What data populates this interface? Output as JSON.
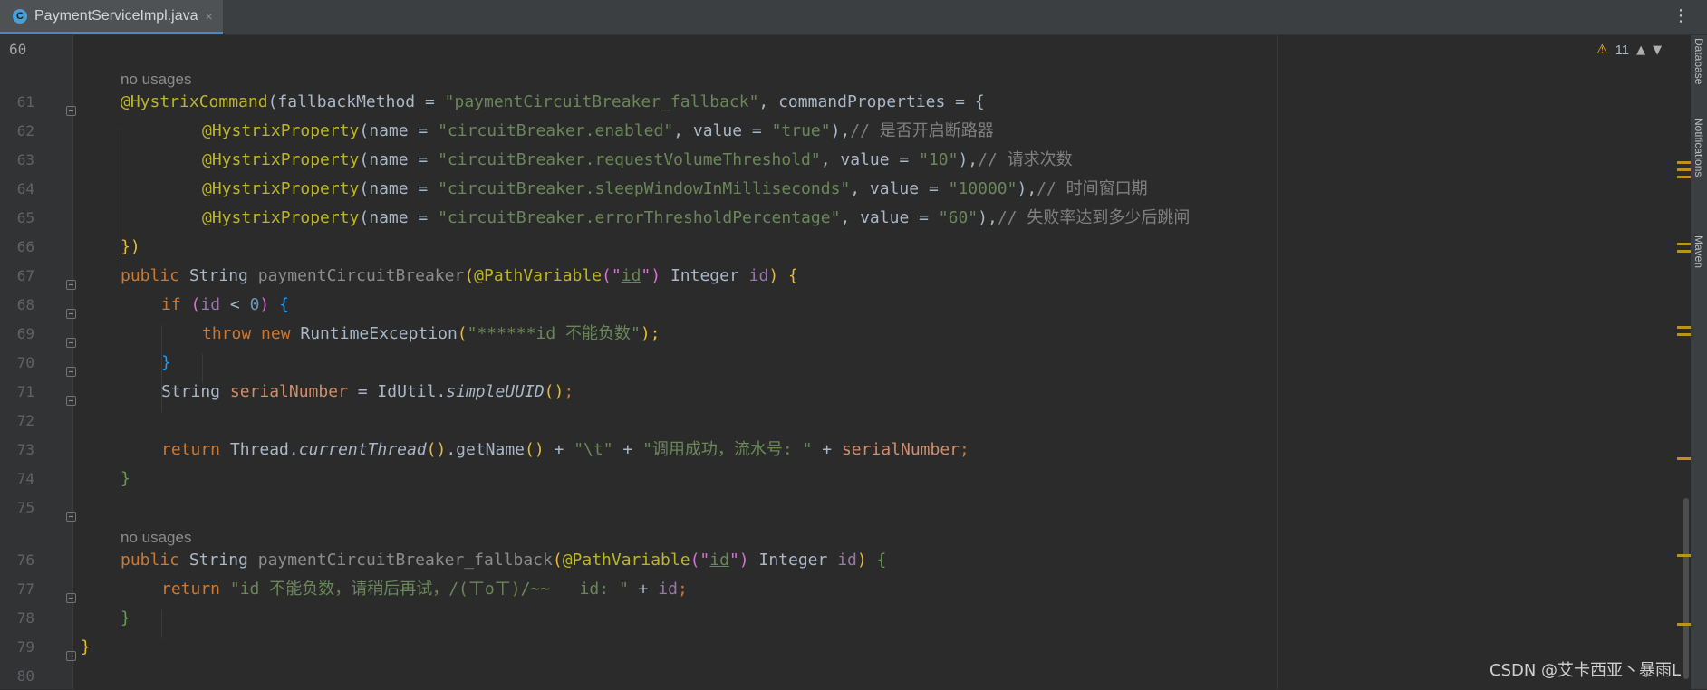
{
  "tab": {
    "icon_letter": "C",
    "title": "PaymentServiceImpl.java",
    "close": "×",
    "menu": "⋮"
  },
  "inspection": {
    "warning_count": "11"
  },
  "side_tabs": [
    "Database",
    "Notifications",
    "Maven"
  ],
  "hints": {
    "no_usages": "no usages"
  },
  "line_numbers": [
    "60",
    "61",
    "62",
    "63",
    "64",
    "65",
    "66",
    "67",
    "68",
    "69",
    "70",
    "71",
    "72",
    "73",
    "74",
    "75",
    "76",
    "77",
    "78",
    "79",
    "80"
  ],
  "code": {
    "l61_ann": "@HystrixCommand",
    "l61_a": "(fallbackMethod = ",
    "l61_s": "\"paymentCircuitBreaker_fallback\"",
    "l61_b": ", commandProperties = {",
    "prop_ann": "@HystrixProperty",
    "name_eq": "(name = ",
    "value_eq": ", value = ",
    "close_comma": "),",
    "l62_name": "\"circuitBreaker.enabled\"",
    "l62_val": "\"true\"",
    "l62_cmt": "// 是否开启断路器",
    "l63_name": "\"circuitBreaker.requestVolumeThreshold\"",
    "l63_val": "\"10\"",
    "l63_cmt": "// 请求次数",
    "l64_name": "\"circuitBreaker.sleepWindowInMilliseconds\"",
    "l64_val": "\"10000\"",
    "l64_cmt": "// 时间窗口期",
    "l65_name": "\"circuitBreaker.errorThresholdPercentage\"",
    "l65_val": "\"60\"",
    "l65_cmt": "// 失败率达到多少后跳闸",
    "l66": "})",
    "kw_public": "public",
    "type_string": " String ",
    "m1": "paymentCircuitBreaker",
    "paren_open": "(",
    "ann_pathvar": "@PathVariable",
    "q_open": "(\"",
    "id_word": "id",
    "q_close": "\")",
    "integer": " Integer ",
    "paren_close": ")",
    "brace_open": " {",
    "kw_if": "if",
    "space": " ",
    "l68_mid": " < ",
    "zero": "0",
    "kw_throw": "throw",
    "kw_new": "new",
    "runtime_ex": " RuntimeException",
    "l69_str": "\"******id 不能负数\"",
    "semi_close": ");",
    "brace_close": "}",
    "l71_type": "String ",
    "serial": "serialNumber",
    "l71_eq": " = IdUtil.",
    "simple_uuid": "simpleUUID",
    "empty_call": "()",
    "semi": ";",
    "kw_return": "return",
    "thread": " Thread.",
    "current_thread": "currentThread",
    "getname": ".getName",
    "plus": " + ",
    "tab_str": "\"\\t\"",
    "l73_str": "\"调用成功，流水号: \"",
    "m2": "paymentCircuitBreaker_fallback",
    "l77_str": "\"id 不能负数，请稍后再试，/(ㄒoㄒ)/~~   id: \"",
    "l79": "}"
  },
  "watermark": "CSDN @艾卡西亚丶暴雨L"
}
